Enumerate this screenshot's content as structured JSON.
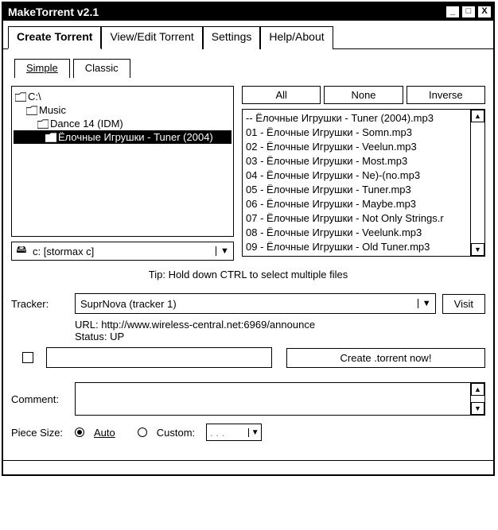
{
  "window": {
    "title": "MakeTorrent v2.1"
  },
  "main_tabs": [
    "Create Torrent",
    "View/Edit Torrent",
    "Settings",
    "Help/About"
  ],
  "sub_tabs": [
    "Simple",
    "Classic"
  ],
  "tree": {
    "root": "C:\\",
    "n1": "Music",
    "n2": "Dance 14 (IDM)",
    "n3": "Ёлочные Игрушки - Tuner (2004)"
  },
  "drive": {
    "label": "c: [stormax c]"
  },
  "sel_buttons": {
    "all": "All",
    "none": "None",
    "inverse": "Inverse"
  },
  "files": [
    "-- Ёлочные Игрушки - Tuner (2004).mp3",
    "01 - Ёлочные Игрушки - Somn.mp3",
    "02 - Ёлочные Игрушки - Veelun.mp3",
    "03 - Ёлочные Игрушки - Most.mp3",
    "04 - Ёлочные Игрушки - Ne)-(no.mp3",
    "05 - Ёлочные Игрушки - Tuner.mp3",
    "06 - Ёлочные Игрушки - Maybe.mp3",
    "07 - Ёлочные Игрушки - Not Only Strings.r",
    "08 - Ёлочные Игрушки - Veelunk.mp3",
    "09 - Ёлочные Игрушки - Old Tuner.mp3"
  ],
  "tip": "Tip: Hold down CTRL to select multiple files",
  "tracker": {
    "label": "Tracker:",
    "value": "SuprNova (tracker 1)",
    "visit": "Visit",
    "url_label": "URL: http://www.wireless-central.net:6969/announce",
    "status_label": "Status: UP"
  },
  "create_button": "Create .torrent now!",
  "comment": {
    "label": "Comment:"
  },
  "piece": {
    "label": "Piece Size:",
    "auto": "Auto",
    "custom": "Custom:",
    "custom_val": ". . ."
  }
}
